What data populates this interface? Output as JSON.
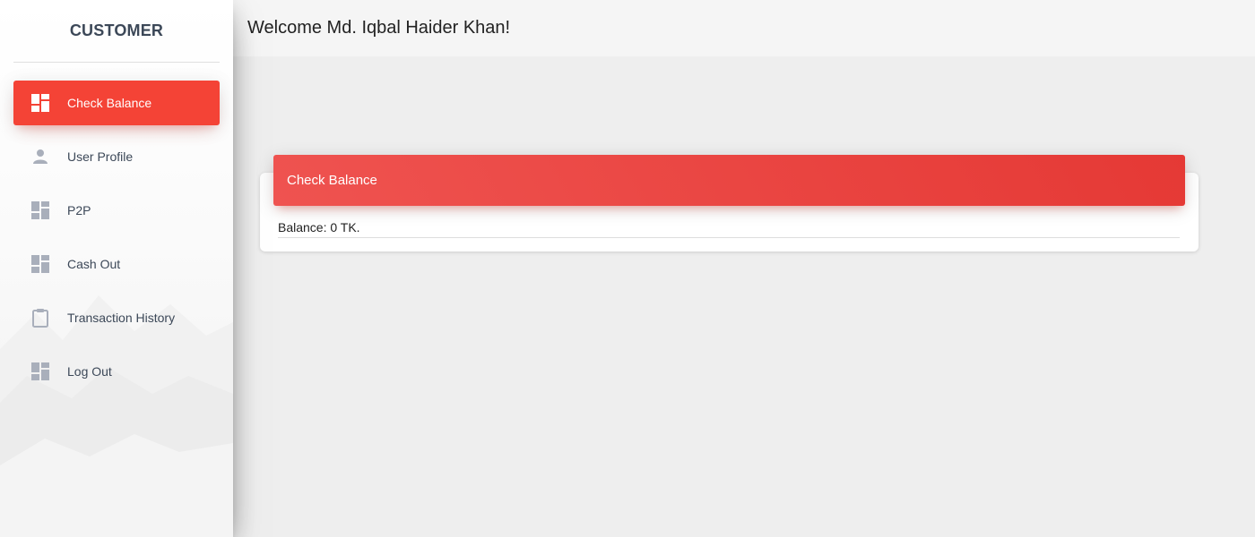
{
  "sidebar": {
    "brand": "CUSTOMER",
    "items": [
      {
        "label": "Check Balance",
        "icon": "dashboard-icon",
        "active": true
      },
      {
        "label": "User Profile",
        "icon": "person-icon",
        "active": false
      },
      {
        "label": "P2P",
        "icon": "dashboard-icon",
        "active": false
      },
      {
        "label": "Cash Out",
        "icon": "dashboard-icon",
        "active": false
      },
      {
        "label": "Transaction History",
        "icon": "clipboard-icon",
        "active": false
      },
      {
        "label": "Log Out",
        "icon": "dashboard-icon",
        "active": false
      }
    ]
  },
  "header": {
    "welcome": "Welcome Md. Iqbal Haider Khan!"
  },
  "card": {
    "title": "Check Balance",
    "balance_text": "Balance: 0 TK."
  },
  "colors": {
    "accent": "#f44336",
    "icon_gray": "#a9afbb",
    "page_bg": "#eeeeee"
  }
}
